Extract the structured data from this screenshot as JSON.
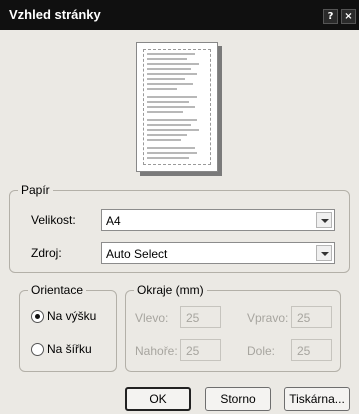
{
  "window": {
    "title": "Vzhled stránky",
    "help_glyph": "?",
    "close_glyph": "×"
  },
  "paper": {
    "group_label": "Papír",
    "size_label": "Velikost:",
    "size_value": "A4",
    "source_label": "Zdroj:",
    "source_value": "Auto Select"
  },
  "orientation": {
    "group_label": "Orientace",
    "portrait_label": "Na výšku",
    "landscape_label": "Na šířku",
    "selected": "portrait"
  },
  "margins": {
    "group_label": "Okraje (mm)",
    "left_label": "Vlevo:",
    "left_value": "25",
    "right_label": "Vpravo:",
    "right_value": "25",
    "top_label": "Nahoře:",
    "top_value": "25",
    "bottom_label": "Dole:",
    "bottom_value": "25"
  },
  "buttons": {
    "ok": "OK",
    "cancel": "Storno",
    "printer": "Tiskárna..."
  }
}
